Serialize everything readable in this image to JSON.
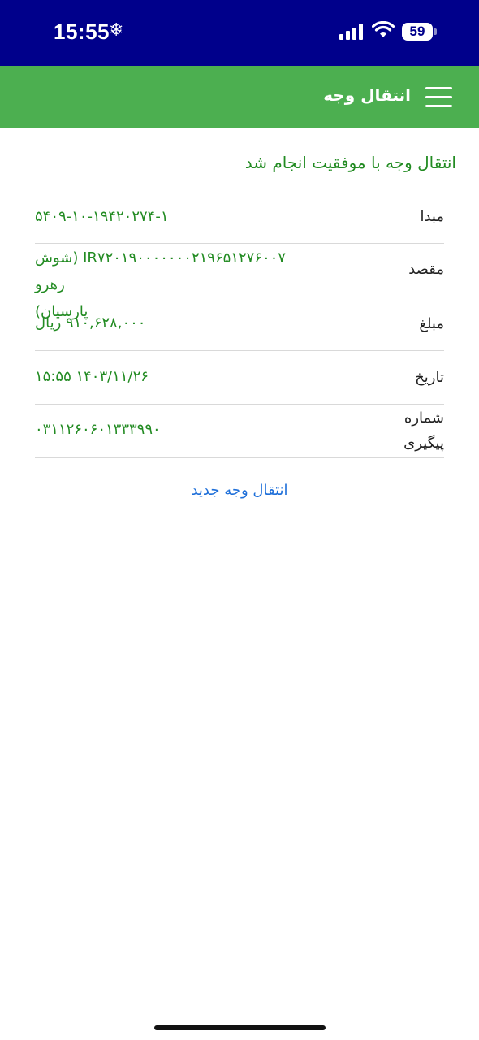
{
  "status_bar": {
    "time": "15:55",
    "battery": "59",
    "icons": [
      "snowflake-icon",
      "cellular-signal-icon",
      "wifi-icon",
      "battery-icon"
    ],
    "background_color": "#00008b"
  },
  "app_bar": {
    "title": "انتقال وجه",
    "menu_icon": "hamburger-menu-icon",
    "background_color": "#4caf50"
  },
  "main": {
    "success_message": "انتقال وجه با موفقیت انجام شد",
    "rows": [
      {
        "label": "مبدا",
        "value": "۵۴۰۹-۱۰-۱۹۴۲۰۲۷۴-۱"
      },
      {
        "label": "مقصد",
        "value": "IR۷۲۰۱۹۰۰۰۰۰۰۰۲۱۹۶۵۱۲۷۶۰۰۷ (شوش رهرو\nپارسیان)"
      },
      {
        "label": "مبلغ",
        "value": "۹۱۰,۶۲۸,۰۰۰ ریال"
      },
      {
        "label": "تاریخ",
        "value": "۱۵:۵۵ ۱۴۰۳/۱۱/۲۶"
      },
      {
        "label": "شماره\nپیگیری",
        "value": "۰۳۱۱۲۶۰۶۰۱۳۳۳۹۹۰"
      }
    ],
    "new_transfer_link": "انتقال وجه جدید",
    "colors": {
      "success_text": "#228b22",
      "link": "#1e6fd9"
    }
  }
}
